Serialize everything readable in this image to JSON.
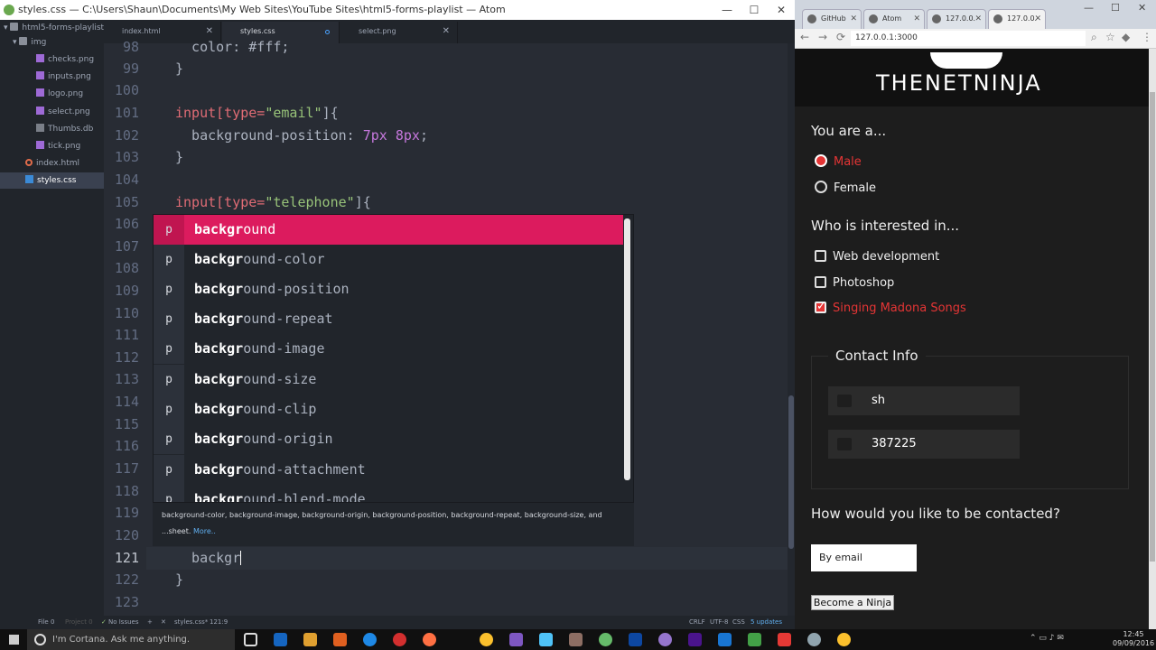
{
  "atom": {
    "title": "styles.css — C:\\Users\\Shaun\\Documents\\My Web Sites\\YouTube Sites\\html5-forms-playlist — Atom",
    "tree": {
      "root": "html5-forms-playlist",
      "folder": "img",
      "files": [
        "checks.png",
        "inputs.png",
        "logo.png",
        "select.png",
        "Thumbs.db",
        "tick.png"
      ],
      "index": "index.html",
      "styles": "styles.css"
    },
    "tabs": [
      {
        "label": "index.html"
      },
      {
        "label": "styles.css"
      },
      {
        "label": "select.png"
      }
    ],
    "line_numbers": [
      "98",
      "99",
      "100",
      "101",
      "102",
      "103",
      "104",
      "105",
      "106",
      "107",
      "108",
      "109",
      "110",
      "111",
      "112",
      "113",
      "114",
      "115",
      "116",
      "117",
      "118",
      "119",
      "120",
      "121",
      "122",
      "123"
    ],
    "code": {
      "l98": "  color: #fff;",
      "l99": "}",
      "l101_sel": "input[type=",
      "l101_str": "\"email\"",
      "l101_end": "]{",
      "l102_prop": "  background-position: ",
      "l102_n1": "7px",
      "l102_n2": "8px",
      "l102_end": ";",
      "l103": "}",
      "l105_sel": "input[type=",
      "l105_str": "\"telephone\"",
      "l105_end": "]{",
      "l121": "  backgr",
      "l122": "}"
    },
    "autocomplete": {
      "prefix": "backgr",
      "type_label": "p",
      "items": [
        {
          "rest": "ound"
        },
        {
          "rest": "ound-color"
        },
        {
          "rest": "ound-position"
        },
        {
          "rest": "ound-repeat"
        },
        {
          "rest": "ound-image"
        },
        {
          "rest": "ound-size"
        },
        {
          "rest": "ound-clip"
        },
        {
          "rest": "ound-origin"
        },
        {
          "rest": "ound-attachment"
        },
        {
          "rest": "ound-blend-mode"
        }
      ],
      "description": "background-color, background-image, background-origin, background-position, background-repeat, background-size, and",
      "description2": "...sheet.",
      "more": "More.."
    },
    "status": {
      "file_count": "File 0",
      "project": "Project 0",
      "issues": "No Issues",
      "file": "styles.css*",
      "pos": "121:9",
      "eol": "CRLF",
      "enc": "UTF-8",
      "grammar": "CSS",
      "updates": "5 updates"
    }
  },
  "chrome": {
    "tabs": [
      {
        "label": "GitHub"
      },
      {
        "label": "Atom"
      },
      {
        "label": "127.0.0."
      },
      {
        "label": "127.0.0."
      }
    ],
    "url": "127.0.0.1:3000",
    "page": {
      "logo": "THENETNINJA",
      "q1": "You are a...",
      "male": "Male",
      "female": "Female",
      "q2": "Who is interested in...",
      "opt_web": "Web development",
      "opt_ps": "Photoshop",
      "opt_sing": "Singing Madona Songs",
      "legend": "Contact Info",
      "name_value": "sh",
      "phone_value": "387225",
      "q3": "How would you like to be contacted?",
      "select_value": "By email",
      "submit": "Become a Ninja"
    }
  },
  "taskbar": {
    "cortana": "I'm Cortana. Ask me anything.",
    "time": "12:45",
    "date": "09/09/2016"
  }
}
